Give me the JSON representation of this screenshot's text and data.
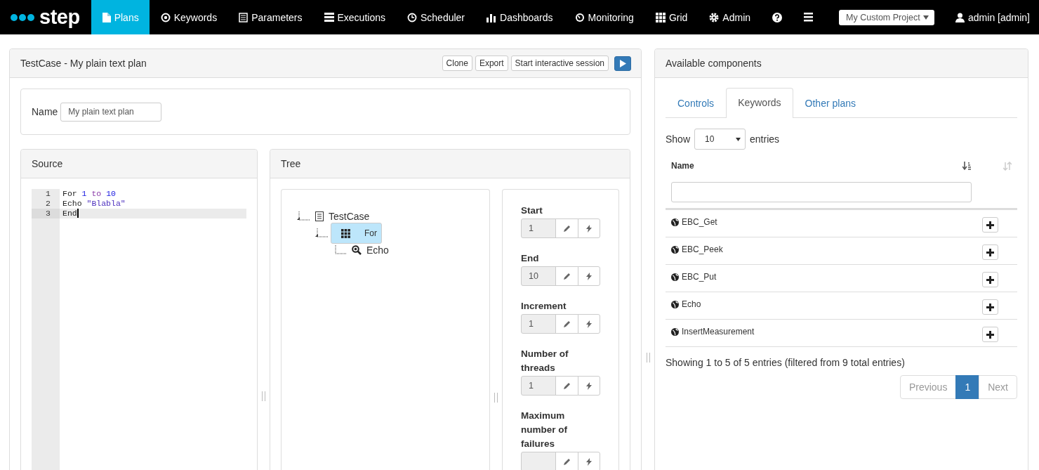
{
  "navbar": {
    "logo": "step",
    "items": [
      {
        "label": "Plans",
        "kind": "file",
        "selected": true
      },
      {
        "label": "Keywords",
        "kind": "target",
        "selected": false
      },
      {
        "label": "Parameters",
        "kind": "list",
        "selected": false
      },
      {
        "label": "Executions",
        "kind": "stack",
        "selected": false
      },
      {
        "label": "Scheduler",
        "kind": "clock",
        "selected": false
      },
      {
        "label": "Dashboards",
        "kind": "bars",
        "selected": false
      },
      {
        "label": "Monitoring",
        "kind": "gauge",
        "selected": false
      },
      {
        "label": "Grid",
        "kind": "grid",
        "selected": false
      },
      {
        "label": "Admin",
        "kind": "gear",
        "selected": false
      },
      {
        "kind": "help",
        "selected": false
      },
      {
        "kind": "menu",
        "selected": false
      }
    ],
    "project": "My Custom Project",
    "user": "admin [admin]"
  },
  "plan": {
    "title": "TestCase - My plain text plan",
    "buttons": [
      "Clone",
      "Export",
      "Start interactive session"
    ],
    "name_label": "Name",
    "name_value": "My plain text plan",
    "source": {
      "title": "Source",
      "lines": [
        {
          "number": "1",
          "current": false,
          "tokens": [
            {
              "text": "For ",
              "kind": "plain"
            },
            {
              "text": "1",
              "kind": "number"
            },
            {
              "text": " to ",
              "kind": "keyword"
            },
            {
              "text": "10",
              "kind": "number"
            }
          ]
        },
        {
          "number": "2",
          "current": false,
          "tokens": [
            {
              "text": "Echo ",
              "kind": "plain"
            },
            {
              "text": "\"Blabla\"",
              "kind": "string"
            }
          ]
        },
        {
          "number": "3",
          "current": true,
          "tokens": [
            {
              "text": "End",
              "kind": "plain"
            }
          ]
        }
      ]
    },
    "tree": {
      "title": "Tree",
      "nodes": [
        {
          "label": "TestCase",
          "kind": "testcase",
          "selected": false,
          "children": [
            {
              "label": "For",
              "kind": "for",
              "selected": true,
              "children": [
                {
                  "label": "Echo",
                  "kind": "keyword",
                  "selected": false
                }
              ]
            }
          ]
        }
      ],
      "properties": [
        {
          "label": "Start",
          "value": "1"
        },
        {
          "label": "End",
          "value": "10"
        },
        {
          "label": "Increment",
          "value": "1"
        },
        {
          "label": "Number of threads",
          "value": "1"
        },
        {
          "label": "Maximum number of failures"
        }
      ]
    }
  },
  "components": {
    "title": "Available components",
    "tabs": [
      {
        "label": "Controls",
        "selected": false
      },
      {
        "label": "Keywords",
        "selected": true
      },
      {
        "label": "Other plans",
        "selected": false
      }
    ],
    "show_label": "Show",
    "page_size": "10",
    "entries_label": "entries",
    "column": "Name",
    "rows": [
      "EBC_Get",
      "EBC_Peek",
      "EBC_Put",
      "Echo",
      "InsertMeasurement"
    ],
    "info": "Showing 1 to 5 of 5 entries (filtered from 9 total entries)",
    "pagination": [
      {
        "label": "Previous",
        "selected": false
      },
      {
        "label": "1",
        "selected": true
      },
      {
        "label": "Next",
        "selected": false
      }
    ]
  }
}
